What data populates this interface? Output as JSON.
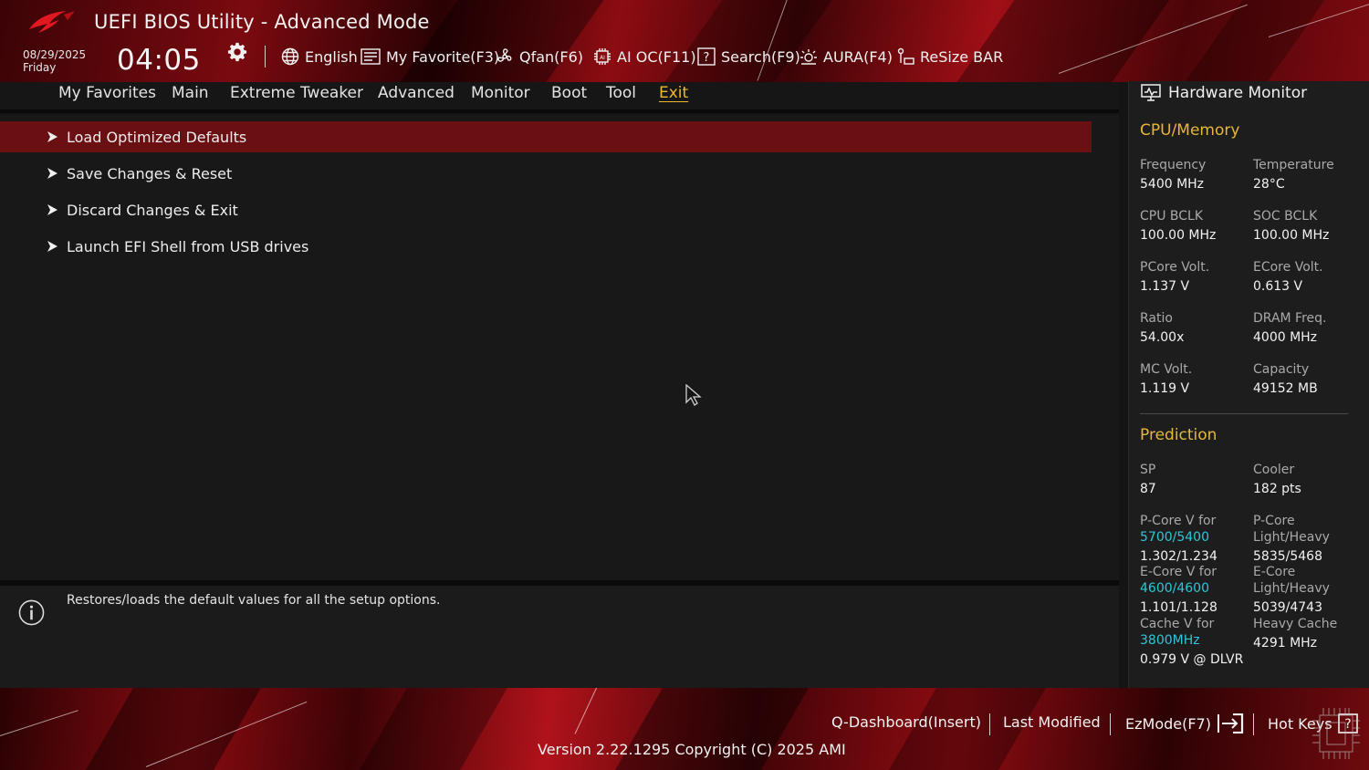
{
  "header": {
    "title": "UEFI BIOS Utility - Advanced Mode",
    "date": "08/29/2025",
    "weekday": "Friday",
    "time": "04:05",
    "toolbar": {
      "language": "English",
      "my_favorite": "My Favorite(F3)",
      "qfan": "Qfan(F6)",
      "ai_oc": "AI OC(F11)",
      "search": "Search(F9)",
      "aura": "AURA(F4)",
      "resize_bar": "ReSize BAR"
    }
  },
  "nav": {
    "tabs": [
      "My Favorites",
      "Main",
      "Extreme Tweaker",
      "Advanced",
      "Monitor",
      "Boot",
      "Tool",
      "Exit"
    ],
    "active": "Exit"
  },
  "menu": {
    "items": [
      "Load Optimized Defaults",
      "Save Changes & Reset",
      "Discard Changes & Exit",
      "Launch EFI Shell from USB drives"
    ],
    "selected_index": 0
  },
  "help": {
    "text": "Restores/loads the default values for all the setup options."
  },
  "hardware_monitor": {
    "title": "Hardware Monitor",
    "cpu_memory": {
      "heading": "CPU/Memory",
      "frequency_label": "Frequency",
      "frequency": "5400 MHz",
      "temperature_label": "Temperature",
      "temperature": "28°C",
      "cpu_bclk_label": "CPU BCLK",
      "cpu_bclk": "100.00 MHz",
      "soc_bclk_label": "SOC BCLK",
      "soc_bclk": "100.00 MHz",
      "pcore_volt_label": "PCore Volt.",
      "pcore_volt": "1.137 V",
      "ecore_volt_label": "ECore Volt.",
      "ecore_volt": "0.613 V",
      "ratio_label": "Ratio",
      "ratio": "54.00x",
      "dram_freq_label": "DRAM Freq.",
      "dram_freq": "4000 MHz",
      "mc_volt_label": "MC Volt.",
      "mc_volt": "1.119 V",
      "capacity_label": "Capacity",
      "capacity": "49152 MB"
    },
    "prediction": {
      "heading": "Prediction",
      "sp_label": "SP",
      "sp": "87",
      "cooler_label": "Cooler",
      "cooler": "182 pts",
      "pcore_v_for_label": "P-Core V for",
      "pcore_v_for_freq": "5700/5400",
      "pcore_v": "1.302/1.234",
      "pcore_lh_label_1": "P-Core",
      "pcore_lh_label_2": "Light/Heavy",
      "pcore_lh": "5835/5468",
      "ecore_v_for_label": "E-Core V for",
      "ecore_v_for_freq": "4600/4600",
      "ecore_v": "1.101/1.128",
      "ecore_lh_label_1": "E-Core",
      "ecore_lh_label_2": "Light/Heavy",
      "ecore_lh": "5039/4743",
      "cache_v_for_label": "Cache V for",
      "cache_v_for_freq": "3800MHz",
      "cache_v": "0.979 V @ DLVR",
      "heavy_cache_label": "Heavy Cache",
      "heavy_cache": "4291 MHz"
    }
  },
  "footer": {
    "q_dashboard": "Q-Dashboard(Insert)",
    "last_modified": "Last Modified",
    "ezmode": "EzMode(F7)",
    "hot_keys": "Hot Keys",
    "version": "Version 2.22.1295 Copyright (C) 2025 AMI"
  },
  "colors": {
    "accent_gold": "#e8b73a",
    "selection_red": "#6a1013",
    "cyan_value": "#2ec6d8"
  }
}
